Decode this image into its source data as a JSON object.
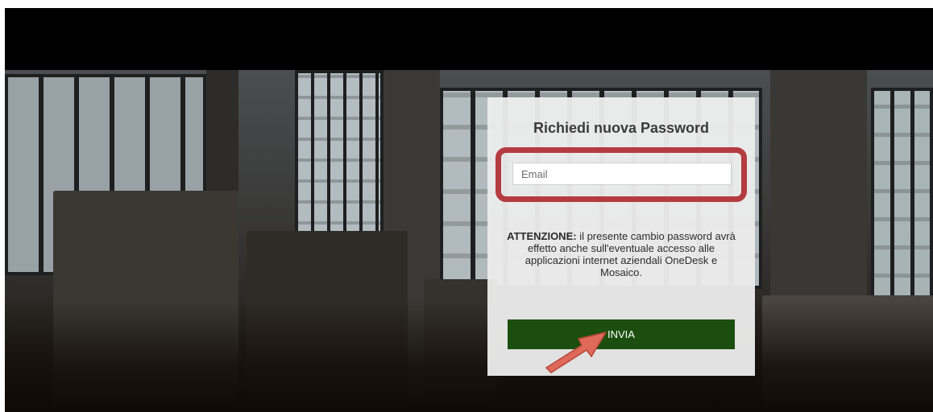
{
  "form": {
    "title": "Richiedi nuova Password",
    "email_placeholder": "Email",
    "email_value": "",
    "notice_bold": "ATTENZIONE:",
    "notice_text": " il presente cambio password avrà effetto anche sull'eventuale accesso alle applicazioni internet aziendali OneDesk e Mosaico.",
    "submit_label": "INVIA"
  },
  "colors": {
    "highlight_border": "#b43c40",
    "submit_bg": "#1c4f0f",
    "arrow": "#e06a5a",
    "card_bg": "#ebebeb"
  },
  "icons": {
    "annotation_arrow": "arrow-pointing-up-right"
  }
}
